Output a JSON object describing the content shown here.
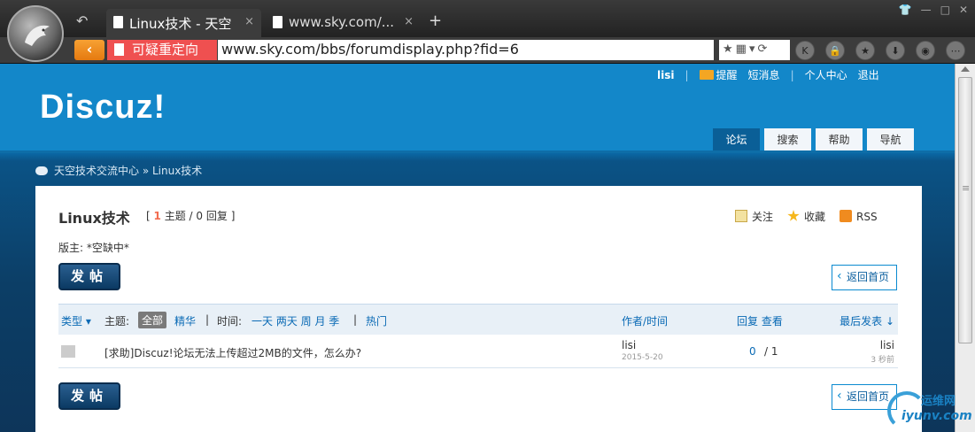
{
  "browser": {
    "tabs": [
      {
        "label": "Linux技术 - 天空",
        "active": true
      },
      {
        "label": "www.sky.com/...",
        "active": false
      }
    ],
    "new_tab": "+",
    "close_symbol": "×",
    "redirect_label": "可疑重定向",
    "url": "www.sky.com/bbs/forumdisplay.php?fid=6",
    "nav_icons": [
      "back-icon",
      "k-icon",
      "lock-icon",
      "star-icon",
      "download-icon",
      "gamepad-icon",
      "more-icon"
    ]
  },
  "site": {
    "logo": "Discuz!",
    "topnav": {
      "user": "lisi",
      "remind": "提醒",
      "sms": "短消息",
      "profile": "个人中心",
      "logout": "退出"
    },
    "tabs": [
      "论坛",
      "搜索",
      "帮助",
      "导航"
    ],
    "active_tab": "论坛",
    "breadcrumb": "天空技术交流中心 » Linux技术"
  },
  "forum": {
    "name": "Linux技术",
    "stats_open": "[",
    "topic_count": "1",
    "topic_label": "主题",
    "stats_sep": "/",
    "reply_text": "0 回复",
    "stats_close": "]",
    "follow": "关注",
    "favorite": "收藏",
    "rss": "RSS",
    "moderator": "版主: *空缺中*",
    "post_button": "发帖",
    "home_button": "返回首页"
  },
  "thread_header": {
    "type": "类型",
    "topic": "主题:",
    "all": "全部",
    "digest": "精华",
    "sep": "|",
    "time": "时间:",
    "time_options": "一天 两天 周 月 季",
    "hot": "热门",
    "author_time": "作者/时间",
    "reply_view": "回复 查看",
    "last_post": "最后发表"
  },
  "threads": [
    {
      "title": "[求助]Discuz!论坛无法上传超过2MB的文件，怎么办?",
      "author": "lisi",
      "date": "2015-5-20",
      "replies": "0",
      "views": "/ 1",
      "last_author": "lisi",
      "last_time": "3 秒前"
    }
  ],
  "watermark": {
    "line1": "运维网",
    "line2": "iyunv.com"
  },
  "colors": {
    "header_blue": "#1387c9",
    "active_tab": "#0a5f97",
    "accent_orange": "#f26c4f",
    "link_blue": "#0a6ab5",
    "redirect_red": "#ef5050"
  }
}
